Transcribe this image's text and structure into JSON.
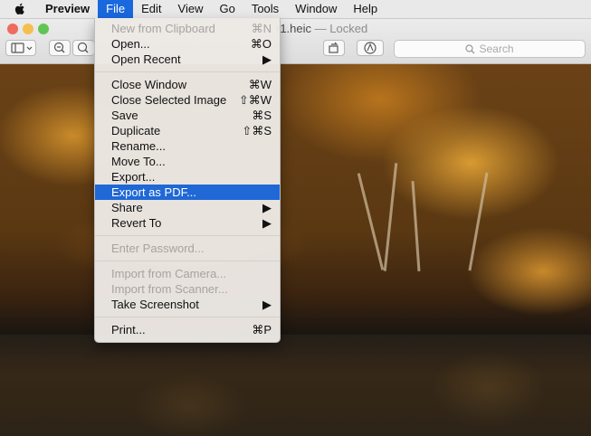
{
  "menubar": {
    "items": [
      "Preview",
      "File",
      "Edit",
      "View",
      "Go",
      "Tools",
      "Window",
      "Help"
    ]
  },
  "window": {
    "title_partial": "r1.heic",
    "title_status": "— Locked",
    "search_placeholder": "Search"
  },
  "file_menu": {
    "items": [
      {
        "label": "New from Clipboard",
        "shortcut": "⌘N",
        "disabled": true
      },
      {
        "label": "Open...",
        "shortcut": "⌘O"
      },
      {
        "label": "Open Recent",
        "shortcut": "▶"
      },
      {
        "label": "Close Window",
        "shortcut": "⌘W"
      },
      {
        "label": "Close Selected Image",
        "shortcut": "⇧⌘W"
      },
      {
        "label": "Save",
        "shortcut": "⌘S"
      },
      {
        "label": "Duplicate",
        "shortcut": "⇧⌘S"
      },
      {
        "label": "Rename...",
        "shortcut": ""
      },
      {
        "label": "Move To...",
        "shortcut": ""
      },
      {
        "label": "Export...",
        "shortcut": ""
      },
      {
        "label": "Export as PDF...",
        "shortcut": "",
        "highlighted": true
      },
      {
        "label": "Share",
        "shortcut": "▶"
      },
      {
        "label": "Revert To",
        "shortcut": "▶"
      },
      {
        "label": "Enter Password...",
        "shortcut": "",
        "disabled": true
      },
      {
        "label": "Import from Camera...",
        "shortcut": "",
        "disabled": true
      },
      {
        "label": "Import from Scanner...",
        "shortcut": "",
        "disabled": true
      },
      {
        "label": "Take Screenshot",
        "shortcut": "▶"
      },
      {
        "label": "Print...",
        "shortcut": "⌘P"
      }
    ]
  },
  "colors": {
    "menu_highlight": "#1f68d6",
    "menubar_active": "#1a68de"
  }
}
